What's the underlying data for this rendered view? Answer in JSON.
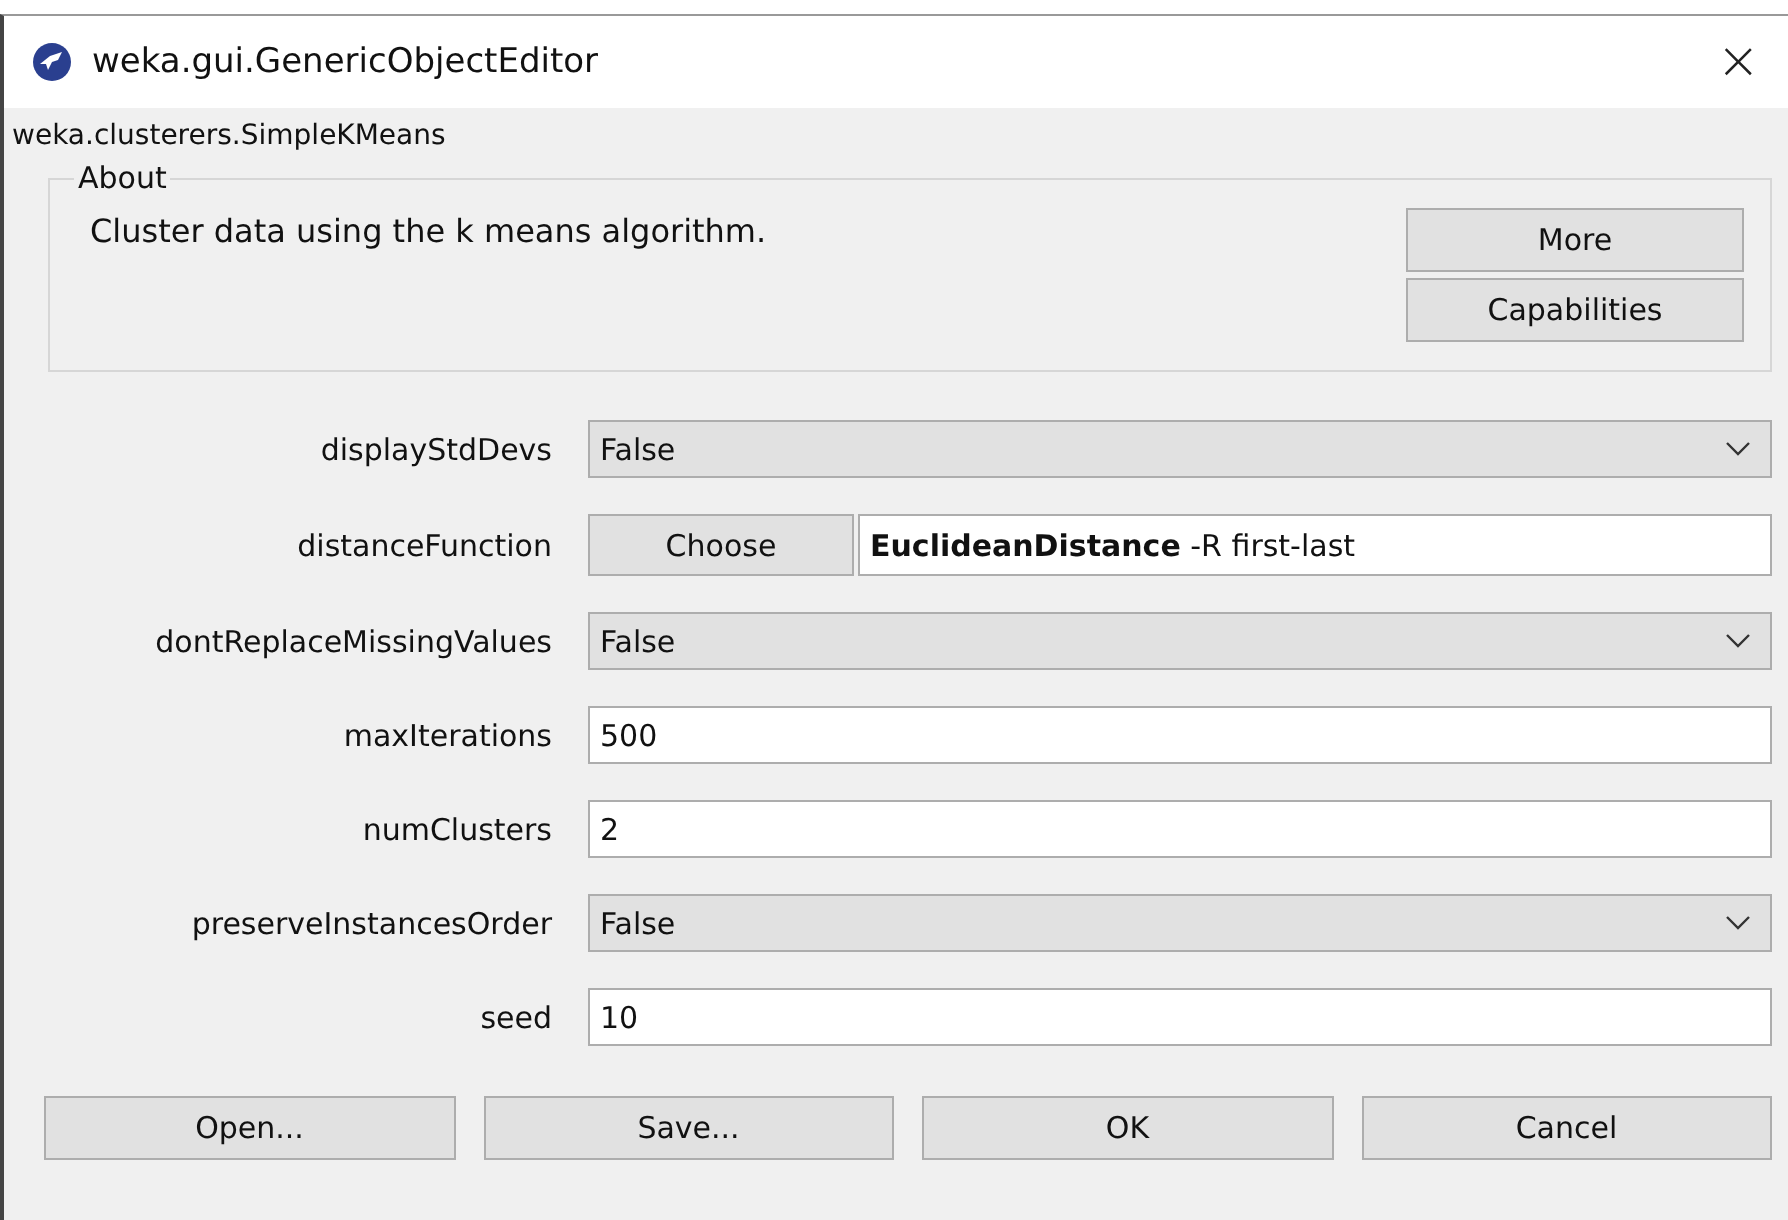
{
  "window": {
    "title": "weka.gui.GenericObjectEditor",
    "close": "×"
  },
  "class_name": "weka.clusterers.SimpleKMeans",
  "about": {
    "legend": "About",
    "text": "Cluster data using the k means algorithm.",
    "buttons": [
      "More",
      "Capabilities"
    ]
  },
  "parameters": [
    {
      "label": "displayStdDevs",
      "kind": "dropdown",
      "value": "False"
    },
    {
      "label": "distanceFunction",
      "kind": "chooser",
      "button": "Choose",
      "value": "**EuclideanDistance** -R first-last"
    },
    {
      "label": "dontReplaceMissingValues",
      "kind": "dropdown",
      "value": "False"
    },
    {
      "label": "maxIterations",
      "kind": "text",
      "value": "500"
    },
    {
      "label": "numClusters",
      "kind": "text",
      "value": "2"
    },
    {
      "label": "preserveInstancesOrder",
      "kind": "dropdown",
      "value": "False"
    },
    {
      "label": "seed",
      "kind": "text",
      "value": "10"
    }
  ],
  "buttons": [
    "Open...",
    "Save...",
    "OK",
    "Cancel"
  ]
}
